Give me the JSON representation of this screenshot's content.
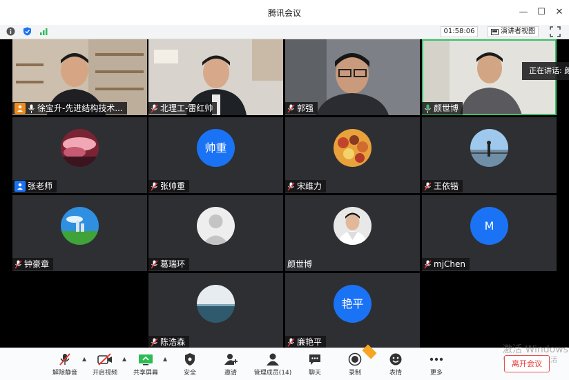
{
  "window": {
    "title": "腾讯会议",
    "minimize": "—",
    "maximize": "☐",
    "close": "✕"
  },
  "infobar": {
    "timer": "01:58:06",
    "speaker_view": "演讲者视图"
  },
  "speaking_banner": "正在讲话: 颜",
  "participants": [
    {
      "name": "徐宝升-先进结构技术...",
      "badge": "orange"
    },
    {
      "name": "北理工-雷红帅"
    },
    {
      "name": "郭强"
    },
    {
      "name": "颜世博"
    },
    {
      "name": "张老师",
      "badge": "blue"
    },
    {
      "name": "张帅重",
      "avatar_text": "帅重"
    },
    {
      "name": "宋维力"
    },
    {
      "name": "王依锴"
    },
    {
      "name": "钟豪章"
    },
    {
      "name": "葛瑞环"
    },
    {
      "name": "颜世博"
    },
    {
      "name": "mjChen",
      "avatar_text": "M"
    },
    {
      "name": "陈浩森"
    },
    {
      "name": "廉艳平",
      "avatar_text": "艳平"
    }
  ],
  "toolbar": {
    "unmute": "解除静音",
    "start_video": "开启视频",
    "share_screen": "共享屏幕",
    "security": "安全",
    "invite": "邀请",
    "manage_members": "管理成员(14)",
    "chat": "聊天",
    "record": "录制",
    "reactions": "表情",
    "more": "更多",
    "leave": "离开会议"
  },
  "watermark": {
    "line1": "激活 Windows",
    "line2": "转到\"设置\"以激活"
  },
  "colors": {
    "accent": "#1a73f5",
    "active_border": "#39c16b",
    "danger": "#e53935",
    "tile_bg": "#2e2f33"
  }
}
